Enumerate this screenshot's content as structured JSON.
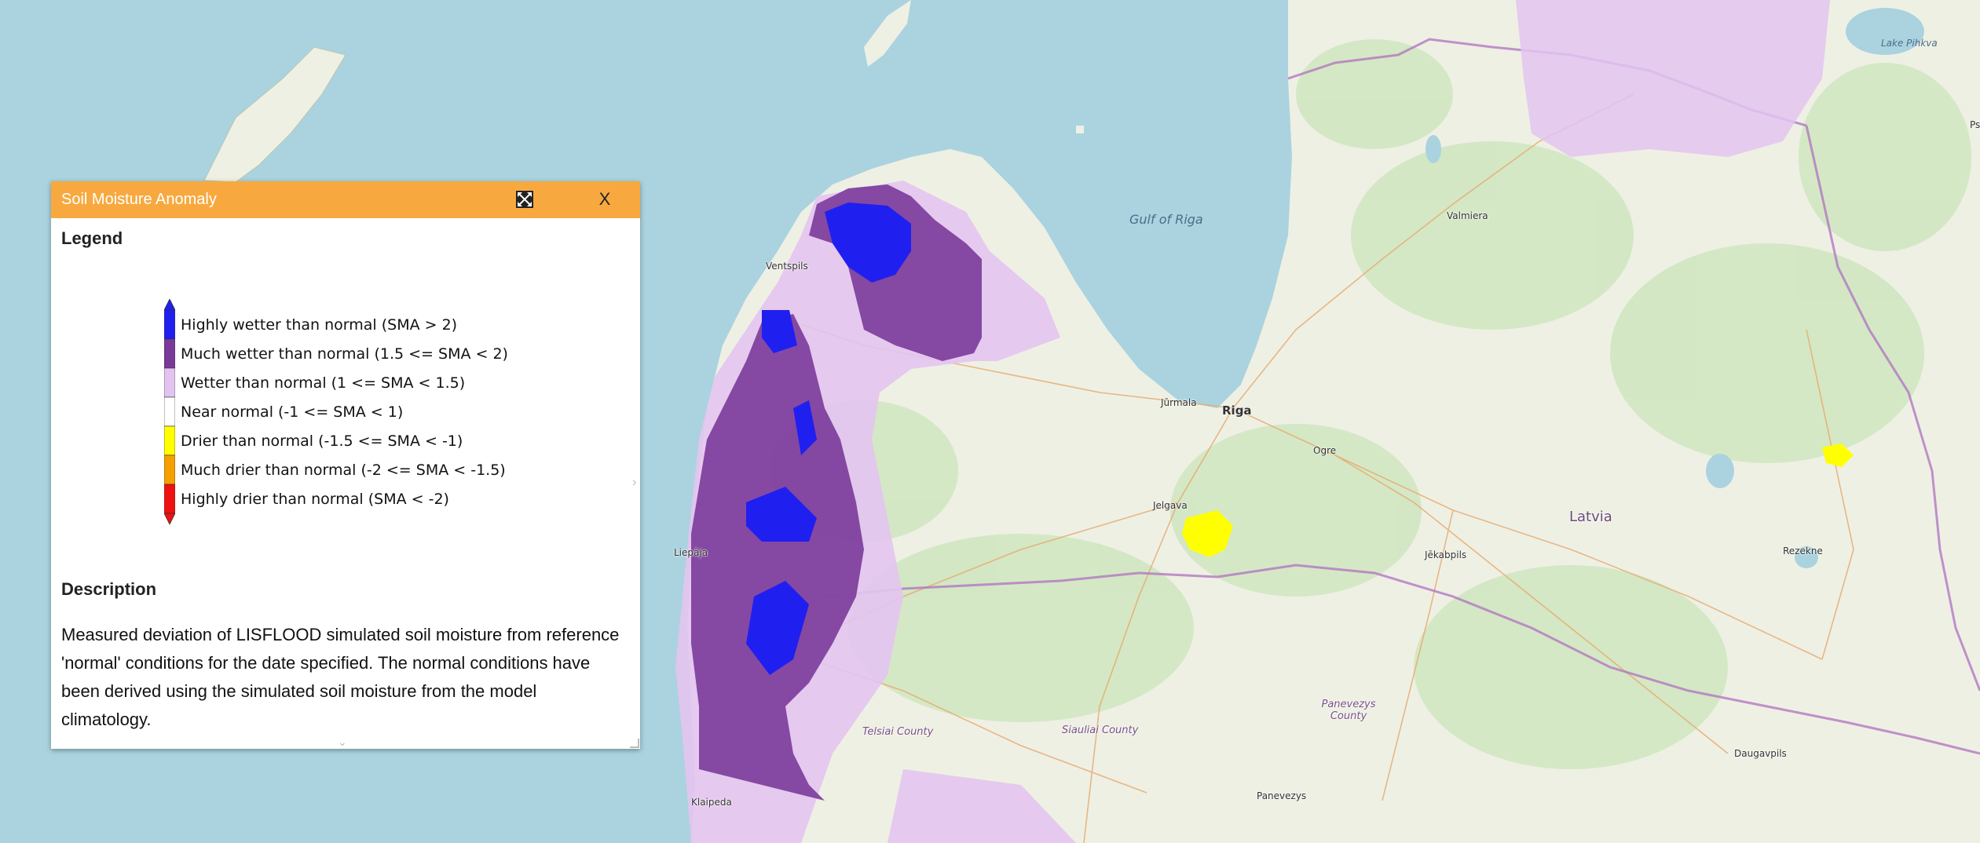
{
  "panel": {
    "title": "Soil Moisture Anomaly",
    "expand_icon": "expand-arrows-icon",
    "close_label": "X",
    "legend_heading": "Legend",
    "legend_items": [
      {
        "label": "Highly wetter than normal (SMA > 2)",
        "color": "#1f1ff0"
      },
      {
        "label": "Much wetter than normal (1.5 <= SMA < 2)",
        "color": "#7a3a9a"
      },
      {
        "label": "Wetter than normal (1 <= SMA < 1.5)",
        "color": "#e3c4f0"
      },
      {
        "label": "Near normal (-1 <= SMA < 1)",
        "color": "#ffffff"
      },
      {
        "label": "Drier than normal (-1.5 <= SMA < -1)",
        "color": "#ffff00"
      },
      {
        "label": "Much drier than normal (-2 <= SMA < -1.5)",
        "color": "#f5a000"
      },
      {
        "label": "Highly drier than normal (SMA < -2)",
        "color": "#ee1111"
      }
    ],
    "description_heading": "Description",
    "description_text": "Measured deviation of LISFLOOD simulated soil moisture from reference 'normal' conditions for the date specified. The normal conditions have been derived using the simulated soil moisture from the model climatology.",
    "side_handle": "›",
    "bottom_handle": "⌄"
  },
  "map": {
    "places": [
      {
        "name": "Gulf of Riga",
        "kind": "water"
      },
      {
        "name": "Ventspils",
        "kind": "city"
      },
      {
        "name": "Valmiera",
        "kind": "city"
      },
      {
        "name": "Jūrmala",
        "kind": "city"
      },
      {
        "name": "Riga",
        "kind": "capital"
      },
      {
        "name": "Ogre",
        "kind": "city"
      },
      {
        "name": "Jelgava",
        "kind": "city"
      },
      {
        "name": "Latvia",
        "kind": "country"
      },
      {
        "name": "Jēkabpils",
        "kind": "city"
      },
      {
        "name": "Rezekne",
        "kind": "city"
      },
      {
        "name": "Liepāja",
        "kind": "city"
      },
      {
        "name": "Telsiai County",
        "kind": "region"
      },
      {
        "name": "Siauliai County",
        "kind": "region"
      },
      {
        "name": "Panevezys County",
        "kind": "region"
      },
      {
        "name": "Panevezys",
        "kind": "city"
      },
      {
        "name": "Daugavpils",
        "kind": "city"
      },
      {
        "name": "Klaipeda",
        "kind": "city"
      },
      {
        "name": "Lake Pihkva",
        "kind": "water"
      },
      {
        "name": "Ps",
        "kind": "city"
      }
    ],
    "colors": {
      "sea": "#aad3df",
      "land": "#eef0e4",
      "forest": "#cfe6c0",
      "border": "#b070c0",
      "road": "#e8a86a"
    }
  }
}
